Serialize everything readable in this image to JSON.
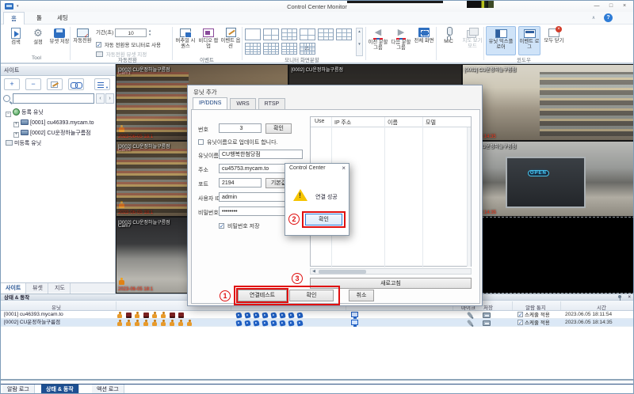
{
  "window": {
    "title": "Control Center Monitor",
    "controls": {
      "min": "—",
      "max": "□",
      "close": "×"
    },
    "collapse": "∧",
    "help": "?"
  },
  "ribbon": {
    "tabs": [
      "홈",
      "툴",
      "세팅"
    ],
    "tool": {
      "label": "Tool",
      "search": "검색",
      "settings": "설정",
      "saveviewset": "뷰셋 저장"
    },
    "autoswitch": {
      "label": "자동전환",
      "button": "자동전환",
      "duration_label": "기간(초)",
      "duration": "10",
      "use_monitor": "자동 전환용 모니터로 사용",
      "assign_viewset": "자동전환 뷰셋 지정"
    },
    "event": {
      "label": "이벤트",
      "virtual": "버추얼 시퀀스",
      "popup": "비디오 팝업",
      "options": "이벤트 옵션"
    },
    "split": {
      "label": "모니터 화면분할",
      "count": "25",
      "patterns": [
        1,
        2,
        3,
        2,
        3,
        3,
        4,
        4,
        4,
        5
      ],
      "prev": "이전 분할 그룹",
      "next": "다음 분할 그룹",
      "full": "전체 화면"
    },
    "mic": "MIC",
    "map": "지도 보기 모드",
    "win": {
      "label": "윈도우",
      "explorer": "유닛 익스플로어",
      "eventlog": "이벤트 로그",
      "closeall": "모두 닫기"
    }
  },
  "sidebar": {
    "title": "사이트",
    "tree": {
      "registered": "등록 유닛",
      "items": [
        {
          "label": "[0001] cu46393.mycam.to"
        },
        {
          "label": "[0002] CU운정하늘구름점"
        }
      ],
      "unregistered": "미등록 유닛"
    },
    "tabs": [
      "사이트",
      "뷰셋",
      "지도"
    ]
  },
  "tiles": [
    {
      "kind": "shelf1",
      "label": "[0002] CU운정하늘구름점",
      "cam": "Cam1",
      "time": "2023-06-05 18:1",
      "motion": true
    },
    {
      "kind": "dark",
      "label": "[0002] CU운정하늘구름점"
    },
    {
      "kind": "store",
      "label": "[0002] CU운정하늘구름점",
      "time": "06.05 18:14:35"
    },
    {
      "kind": "shelf2",
      "label": "[0002] CU운정하늘구름점",
      "cam": "Cam4",
      "time": "2023-06-05 18:1",
      "motion": true
    },
    {
      "kind": "dark"
    },
    {
      "kind": "front",
      "label": "[0002] CU운정하늘구름점",
      "time": "06-05 18:14:35",
      "sign": "OPEN"
    },
    {
      "kind": "street",
      "label": "[0002] CU운정하늘구름점",
      "cam": "Cam7",
      "time": "2023-06-05 18:1",
      "motion": true
    },
    {
      "kind": "dark"
    },
    {
      "kind": "empty"
    }
  ],
  "dialog": {
    "title": "유닛 추가",
    "tabs": [
      "IP/DDNS",
      "WRS",
      "RTSP"
    ],
    "fields": {
      "number_label": "번호",
      "number": "3",
      "check_btn": "확인",
      "update_check": "유닛이름으로 업데이트 합니다.",
      "name_label": "유닛이름",
      "name": "CU행복한첨당점",
      "addr_label": "주소",
      "addr": "cu45753.mycam.to",
      "port_label": "포트",
      "port": "2194",
      "default_btn": "기본값",
      "id_label": "사용자 ID",
      "id": "admin",
      "pw_label": "비밀번호",
      "pw": "••••••••",
      "savepw": "비밀번호 저장"
    },
    "list": {
      "columns": [
        "Use",
        "IP 주소",
        "이름",
        "모델"
      ],
      "refresh": "새로고침"
    },
    "buttons": {
      "test": "연결테스트",
      "ok": "확인",
      "cancel": "취소"
    }
  },
  "popup": {
    "title": "Control Center",
    "message": "연결 성공",
    "ok": "확인",
    "close": "×"
  },
  "annotations": {
    "one": "1",
    "two": "2",
    "three": "3"
  },
  "status_panel": {
    "header": "상태 & 동작",
    "columns": {
      "unit": "유닛",
      "mic": "마이크",
      "save": "저장",
      "alarm": "알람 통지",
      "time": "시간"
    },
    "schedule": "스케줄 적용",
    "rows": [
      {
        "unit": "[0001] cu46393.mycam.to",
        "motion": [
          "p",
          "d",
          "p",
          "d",
          "p",
          "p",
          "d",
          "d"
        ],
        "cams": 8,
        "time": "2023.06.05 18:11:54"
      },
      {
        "unit": "[0002] CU운정하늘구름점",
        "motion": [
          "p",
          "p",
          "p",
          "p",
          "p",
          "p",
          "p",
          "p",
          "p"
        ],
        "cams": 8,
        "time": "2023.06.05 18:14:35"
      }
    ]
  },
  "bottom_tabs": [
    "알람 로그",
    "상태 & 동작",
    "액션 로그"
  ]
}
